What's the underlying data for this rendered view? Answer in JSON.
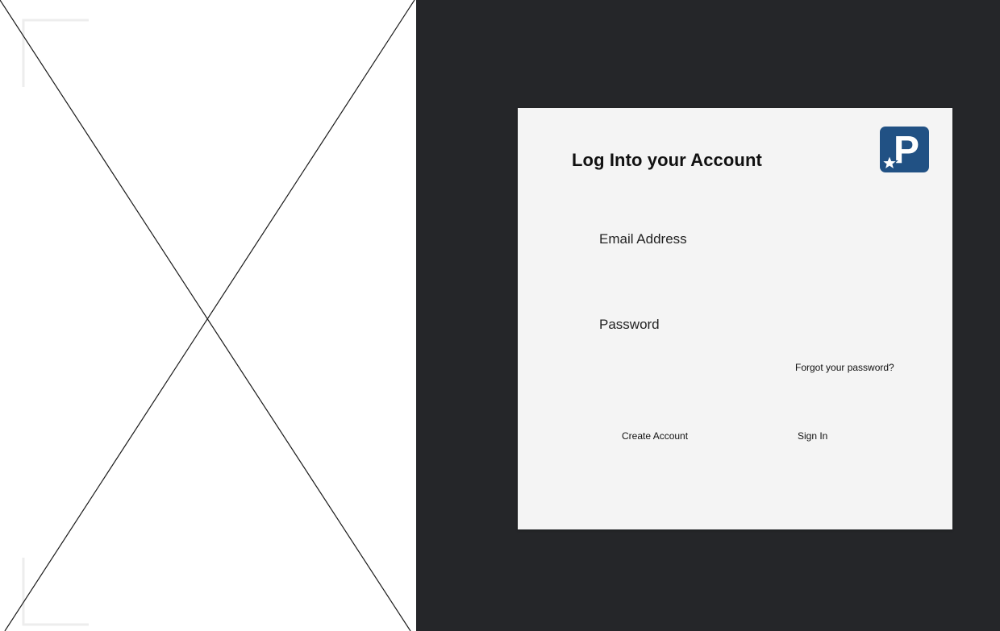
{
  "placeholder": {
    "icon": "image-placeholder-cross"
  },
  "login": {
    "title": "Log Into your Account",
    "logo_icon": "parking-star-logo",
    "logo_letter": "P",
    "logo_color": "#215184",
    "email_label": "Email Address",
    "email_value": "",
    "password_label": "Password",
    "password_value": "",
    "forgot_link": "Forgot your password?",
    "create_account": "Create Account",
    "sign_in": "Sign In"
  },
  "colors": {
    "background": "#252629",
    "card": "#f4f4f4",
    "placeholder_bg": "#ffffff"
  }
}
